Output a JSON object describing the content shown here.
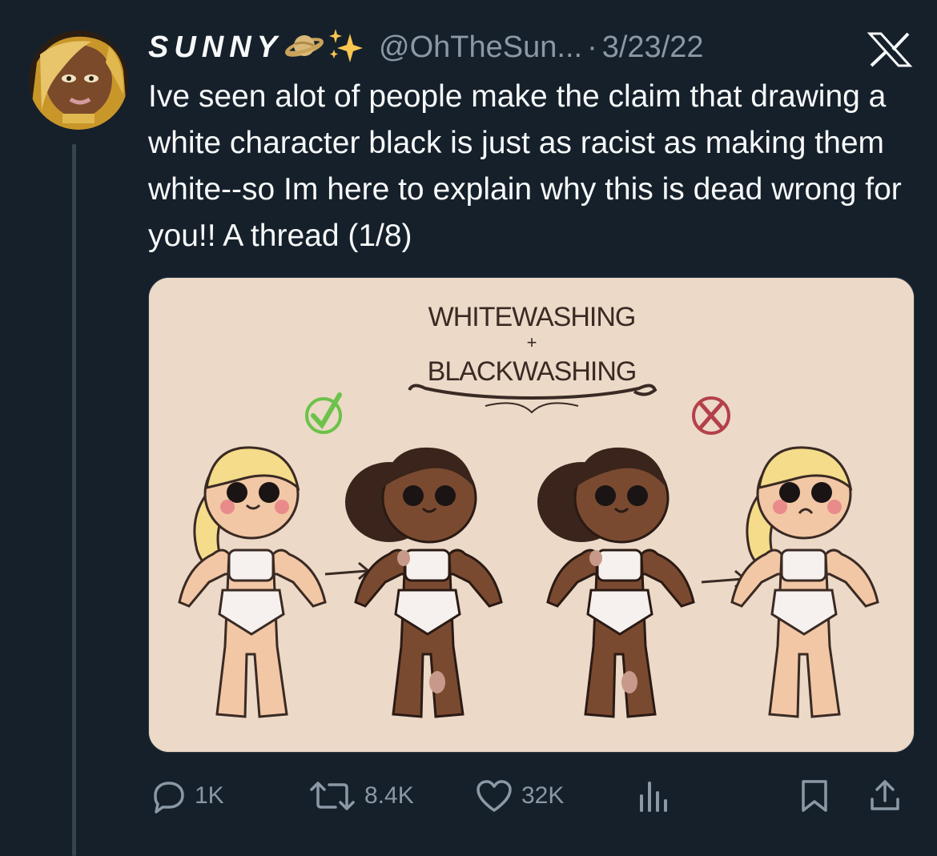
{
  "tweet": {
    "display_name": "SUNNY",
    "name_emojis": [
      "saturn-icon",
      "sparkles-icon"
    ],
    "handle": "@OhTheSun...",
    "separator": "·",
    "date": "3/23/22",
    "text": "Ive seen alot of people make the claim that drawing a white character black is just as racist as making them white--so Im here to explain why this is dead wrong for you!! A thread (1/8)"
  },
  "media": {
    "title_line1": "WHITEWASHING",
    "title_plus": "+",
    "title_line2": "BLACKWASHING",
    "background_color": "#ecd9c7",
    "check_color": "#6cc24a",
    "cross_color": "#b3404a"
  },
  "actions": {
    "reply_count": "1K",
    "retweet_count": "8.4K",
    "like_count": "32K"
  },
  "colors": {
    "background": "#15202b",
    "text_primary": "#f7f9f9",
    "text_secondary": "#8b98a5",
    "thread_line": "#38444d"
  }
}
